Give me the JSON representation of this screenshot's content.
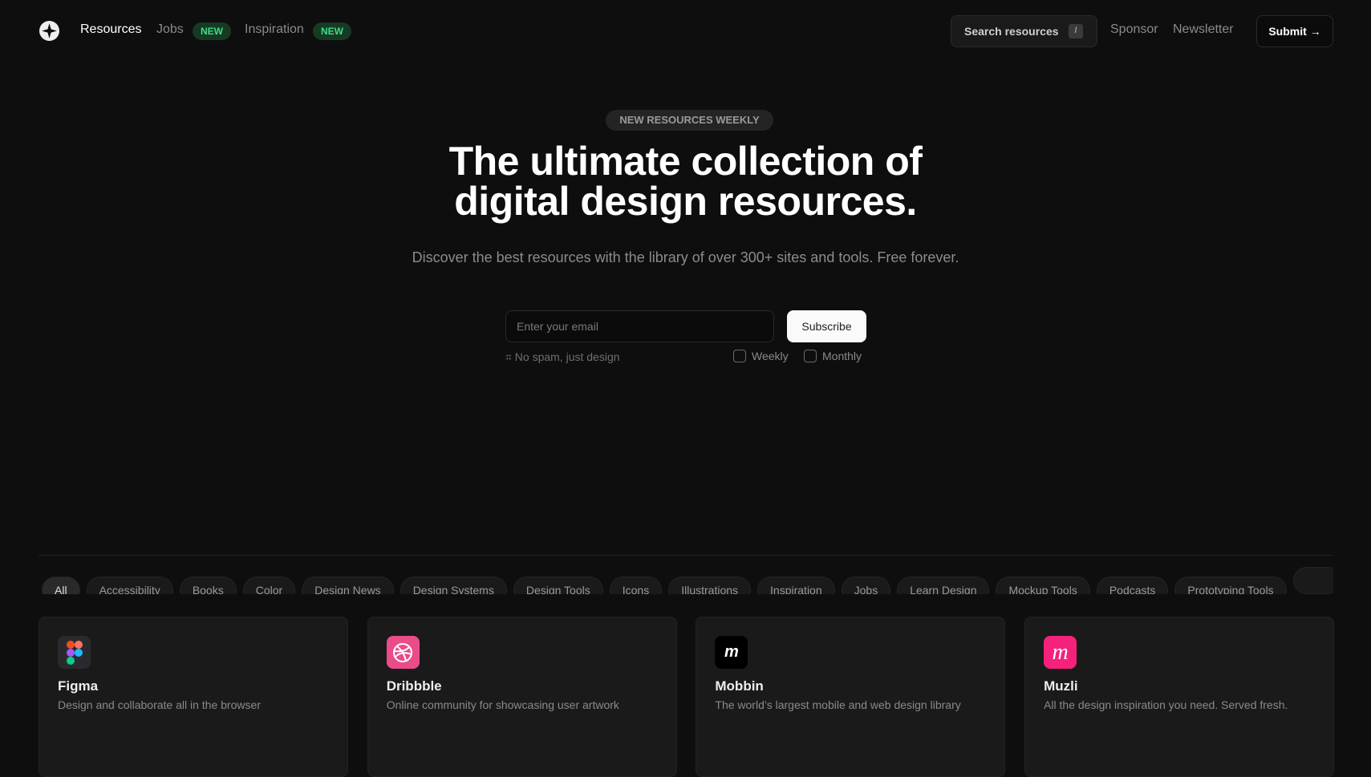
{
  "nav": {
    "resources": "Resources",
    "jobs": "Jobs",
    "jobs_badge": "NEW",
    "inspiration": "Inspiration",
    "inspiration_badge": "NEW",
    "search": "Search resources",
    "search_key": "/",
    "sponsor": "Sponsor",
    "newsletter": "Newsletter",
    "submit": "Submit →"
  },
  "hero": {
    "badge": "NEW RESOURCES WEEKLY",
    "title_line1": "The ultimate collection of",
    "title_line2": "digital design resources.",
    "subtitle": "Discover the best resources with the library of over 300+ sites and tools. Free forever.",
    "email_placeholder": "Enter your email",
    "subscribe": "Subscribe",
    "note_icon": "hash-icon",
    "note": "No spam, just design",
    "weekly": "Weekly",
    "monthly": "Monthly"
  },
  "categories": [
    "All",
    "Accessibility",
    "Books",
    "Color",
    "Design News",
    "Design Systems",
    "Design Tools",
    "Icons",
    "Illustrations",
    "Inspiration",
    "Jobs",
    "Learn Design",
    "Mockup Tools",
    "Podcasts",
    "Prototyping Tools",
    ""
  ],
  "cards": [
    {
      "title": "Figma",
      "desc": "Design and collaborate all in the browser",
      "icon": "figma-logo",
      "color": "#2a2a2e"
    },
    {
      "title": "Dribbble",
      "desc": "Online community for showcasing user artwork",
      "icon": "dribbble-logo",
      "color": "#ea4c89"
    },
    {
      "title": "Mobbin",
      "desc": "The world’s largest mobile and web design library",
      "icon": "mobbin-logo",
      "color": "#000000"
    },
    {
      "title": "Muzli",
      "desc": "All the design inspiration you need. Served fresh.",
      "icon": "muzli-logo",
      "color": "#f5217a"
    }
  ]
}
